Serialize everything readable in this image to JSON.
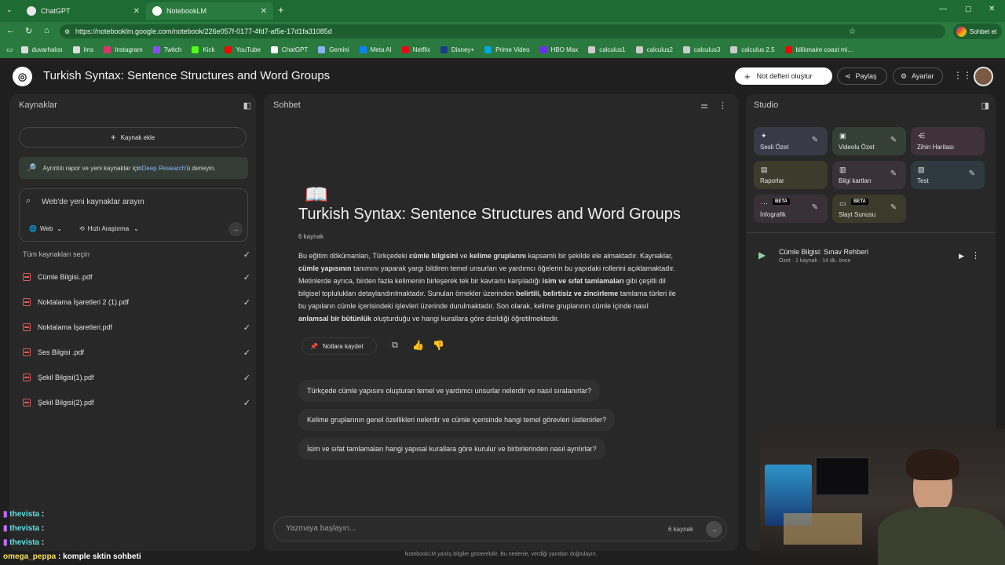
{
  "browser": {
    "tabs": [
      {
        "title": "ChatGPT"
      },
      {
        "title": "NotebookLM"
      }
    ],
    "url": "https://notebooklm.google.com/notebook/226e057f-0177-4fd7-af5e-17d1fa31085d",
    "profile_button": "Sohbet et",
    "bookmarks": [
      "duvarhalısı",
      "lms",
      "Instagram",
      "Twitch",
      "Kick",
      "YouTube",
      "ChatGPT",
      "Gemini",
      "Meta AI",
      "Netflix",
      "Disney+",
      "Prime Video",
      "HBO Max",
      "calculus1",
      "calculus2",
      "calculus3",
      "calculus 2.5",
      "billionaire coast mi..."
    ]
  },
  "header": {
    "title": "Turkish Syntax: Sentence Structures and Word Groups",
    "new_notebook": "Not defteri oluştur",
    "share": "Paylaş",
    "settings": "Ayarlar"
  },
  "sources": {
    "title": "Kaynaklar",
    "add_source": "Kaynak ekle",
    "deep_research_pre": "Ayrıntılı rapor ve yeni kaynaklar için ",
    "deep_research_link": "Deep Research",
    "deep_research_post": "'ü deneyin.",
    "search_placeholder": "Web'de yeni kaynaklar arayın",
    "web_filter": "Web",
    "research_filter": "Hızlı Araştırma",
    "select_all": "Tüm kaynakları seçin",
    "items": [
      "Cümle Bilgisi..pdf",
      "Noktalama İşaretleri 2 (1).pdf",
      "Noktalama İşaretleri.pdf",
      "Ses Bilgisi .pdf",
      "Şekil Bilgisi(1).pdf",
      "Şekil Bilgisi(2).pdf"
    ]
  },
  "chat": {
    "title": "Sohbet",
    "emoji": "📖",
    "notebook_title": "Turkish Syntax: Sentence Structures and Word Groups",
    "source_count": "6 kaynak",
    "summary": [
      {
        "t": "Bu eğitim dökümanları, Türkçedeki ",
        "b": false
      },
      {
        "t": "cümle bilgisini",
        "b": true
      },
      {
        "t": " ve ",
        "b": false
      },
      {
        "t": "kelime gruplarını",
        "b": true
      },
      {
        "t": " kapsamlı bir şekilde ele almaktadır. Kaynaklar, ",
        "b": false
      },
      {
        "t": "cümle yapısının",
        "b": true
      },
      {
        "t": " tanımını yaparak yargı bildiren temel unsurları ve yardımcı öğelerin bu yapıdaki rollerini açıklamaktadır. Metinlerde ayrıca, birden fazla kelimenin birleşerek tek bir kavramı karşıladığı ",
        "b": false
      },
      {
        "t": "isim ve sıfat tamlamaları",
        "b": true
      },
      {
        "t": " gibi çeşitli dil bilgisel toplulukları detaylandırılmaktadır. Sunulan örnekler üzerinden ",
        "b": false
      },
      {
        "t": "belirtili, belirtisiz ve zincirleme",
        "b": true
      },
      {
        "t": " tamlama türleri ile bu yapıların cümle içerisindeki işlevleri üzerinde durulmaktadır. Son olarak, kelime gruplarının cümle içinde nasıl ",
        "b": false
      },
      {
        "t": "anlamsal bir bütünlük",
        "b": true
      },
      {
        "t": " oluşturduğu ve hangi kurallara göre dizildiği öğretilmektedir.",
        "b": false
      }
    ],
    "save_note": "Notlara kaydet",
    "suggestions": [
      "Türkçede cümle yapısını oluşturan temel ve yardımcı unsurlar nelerdir ve nasıl sıralanırlar?",
      "Kelime gruplarının genel özellikleri nelerdir ve cümle içerisinde hangi temel görevleri üstlenirler?",
      "İsim ve sıfat tamlamaları hangi yapısal kurallara göre kurulur ve birbirlerinden nasıl ayrılırlar?"
    ],
    "input_placeholder": "Yazmaya başlayın...",
    "input_count": "6 kaynak",
    "disclaimer": "NotebookLM yanlış bilgiler gösterebilir. Bu nedenle, verdiği yanıtları doğrulayın."
  },
  "studio": {
    "title": "Studio",
    "tiles": [
      {
        "label": "Sesli Özet",
        "icon": "audio-wave-icon"
      },
      {
        "label": "Videolu Özet",
        "icon": "video-icon"
      },
      {
        "label": "Zihin Haritası",
        "icon": "mindmap-icon"
      },
      {
        "label": "Raporlar",
        "icon": "report-icon"
      },
      {
        "label": "Bilgi kartları",
        "icon": "flashcard-icon"
      },
      {
        "label": "Test",
        "icon": "quiz-icon"
      },
      {
        "label": "İnfografik",
        "icon": "infographic-icon",
        "badge": "BETA"
      },
      {
        "label": "Slayt Sunusu",
        "icon": "slides-icon",
        "badge": "BETA"
      }
    ],
    "note_title": "Cümle Bilgisi: Sınav Rehberi",
    "note_meta": "Özet · 1 kaynak · 14 dk. önce"
  },
  "stream_chat": [
    {
      "user": "thevista",
      "msg": ":"
    },
    {
      "user": "thevista",
      "msg": ":"
    },
    {
      "user": "thevista",
      "msg": ":"
    },
    {
      "user": "omega_peppa",
      "msg": ": komple sktin sohbeti"
    }
  ]
}
